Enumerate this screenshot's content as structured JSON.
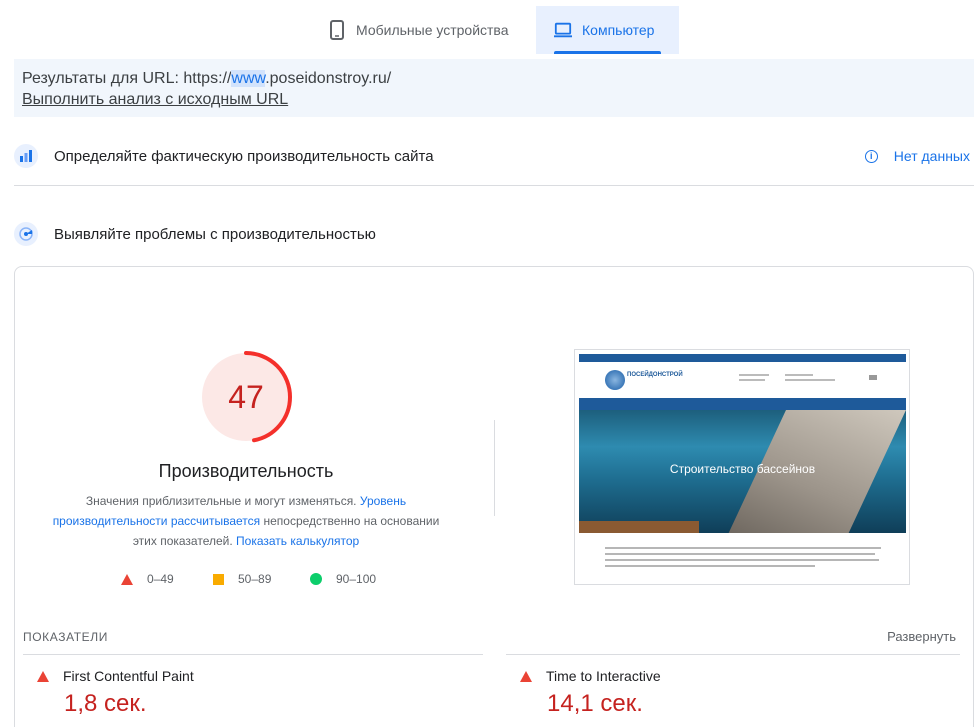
{
  "tabs": [
    {
      "label": "Мобильные устройства",
      "icon": "smartphone-icon",
      "active": false
    },
    {
      "label": "Компьютер",
      "icon": "laptop-icon",
      "active": true
    }
  ],
  "url_banner": {
    "prefix": "Результаты для URL: https://",
    "highlight": "www",
    "suffix": ".poseidonstroy.ru/",
    "reanalyze_link": "Выполнить анализ с исходным URL"
  },
  "field_data": {
    "icon": "users-icon",
    "title": "Определяйте фактическую производительность сайта",
    "status_icon": "info-icon",
    "status": "Нет данных"
  },
  "lab_data": {
    "icon": "lighthouse-icon",
    "title": "Выявляйте проблемы с производительностью"
  },
  "performance": {
    "score": "47",
    "score_fraction": 0.47,
    "label": "Производительность",
    "desc_1": "Значения приблизительные и могут изменяться.",
    "desc_link_1": "Уровень производительности рассчитывается",
    "desc_2": "непосредственно на основании этих показателей.",
    "desc_link_2": "Показать калькулятор",
    "legend": [
      {
        "range": "0–49",
        "shape": "triangle",
        "color": "#ea4335"
      },
      {
        "range": "50–89",
        "shape": "square",
        "color": "#f9ab00"
      },
      {
        "range": "90–100",
        "shape": "circle",
        "color": "#0cce6b"
      }
    ],
    "score_color": "#c5221f",
    "arc_color": "#f4302b",
    "track_color": "#fce8e6"
  },
  "screenshot": {
    "logo_text": "ПОСЕЙДОНСТРОЙ",
    "hero_title": "Строительство бассейнов"
  },
  "metrics": {
    "section_label": "ПОКАЗАТЕЛИ",
    "expand_label": "Развернуть",
    "items": [
      {
        "name": "First Contentful Paint",
        "value": "1,8 сек."
      },
      {
        "name": "Time to Interactive",
        "value": "14,1 сек."
      }
    ]
  },
  "colors": {
    "accent": "#1a73e8",
    "fail": "#c5221f",
    "tab_active_bg": "#e8f0fe"
  }
}
